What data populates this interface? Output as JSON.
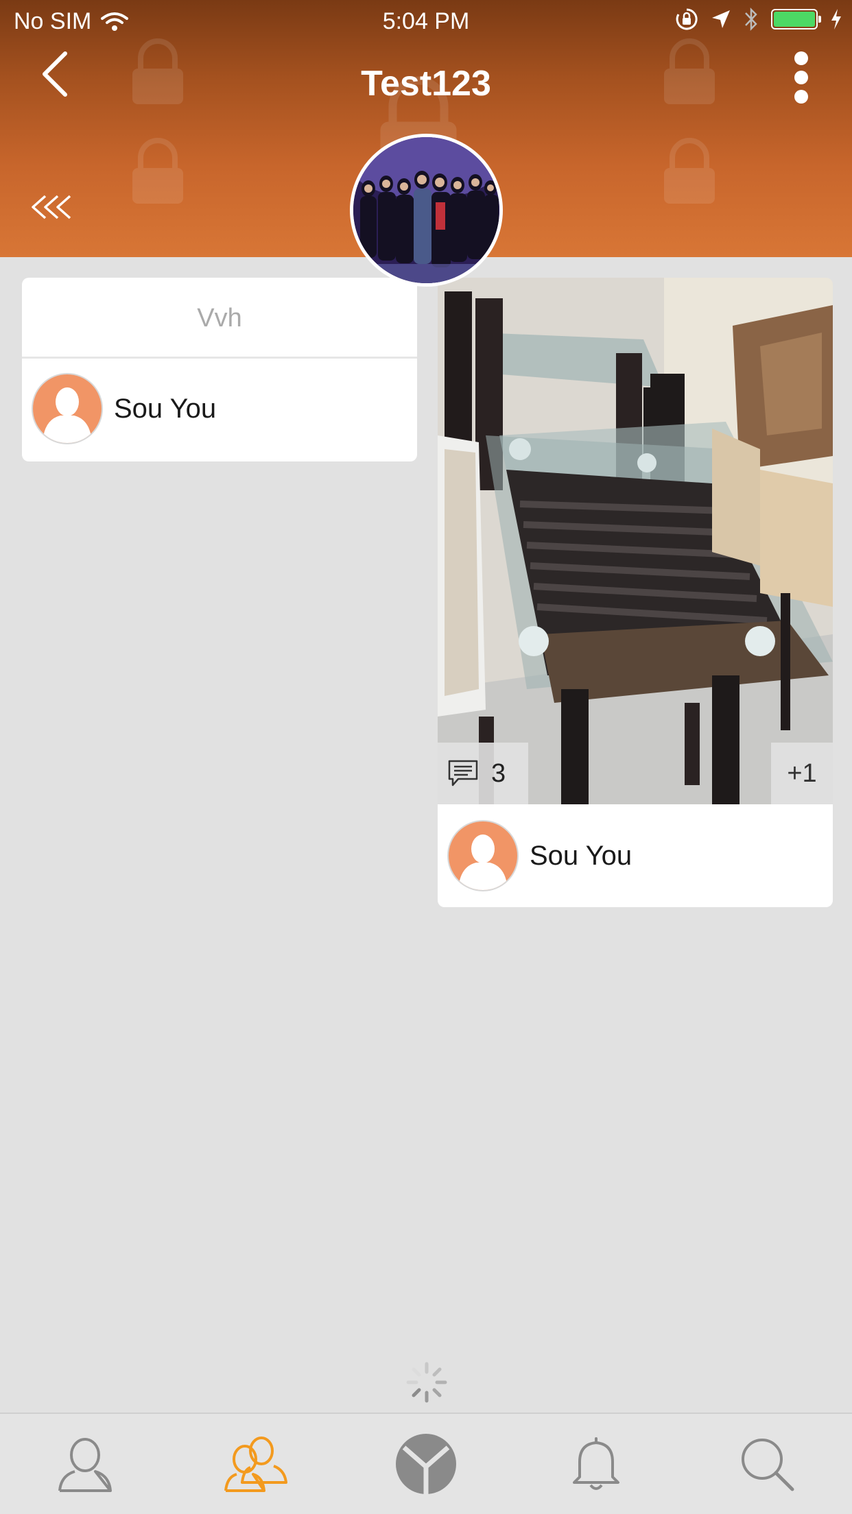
{
  "status_bar": {
    "carrier": "No SIM",
    "time": "5:04 PM"
  },
  "header": {
    "title": "Test123",
    "back_icon": "chevron-left-icon",
    "menu_icon": "vertical-ellipsis-icon",
    "collapse_icon": "double-chevron-left-icon"
  },
  "posts": [
    {
      "type": "text",
      "text": "Vvh",
      "author": "Sou You"
    },
    {
      "type": "photo",
      "comment_count": "3",
      "plus_label": "+1",
      "author": "Sou You"
    }
  ],
  "tab_bar": {
    "active_index": 1,
    "active_color": "#f39a1e",
    "items": [
      {
        "icon": "profile-icon"
      },
      {
        "icon": "groups-icon"
      },
      {
        "icon": "home-logo-icon"
      },
      {
        "icon": "bell-icon"
      },
      {
        "icon": "search-icon"
      }
    ]
  },
  "colors": {
    "header_top": "#7a3a14",
    "header_bottom": "#d87636",
    "background": "#e1e1e1",
    "avatar_placeholder": "#f19566"
  }
}
